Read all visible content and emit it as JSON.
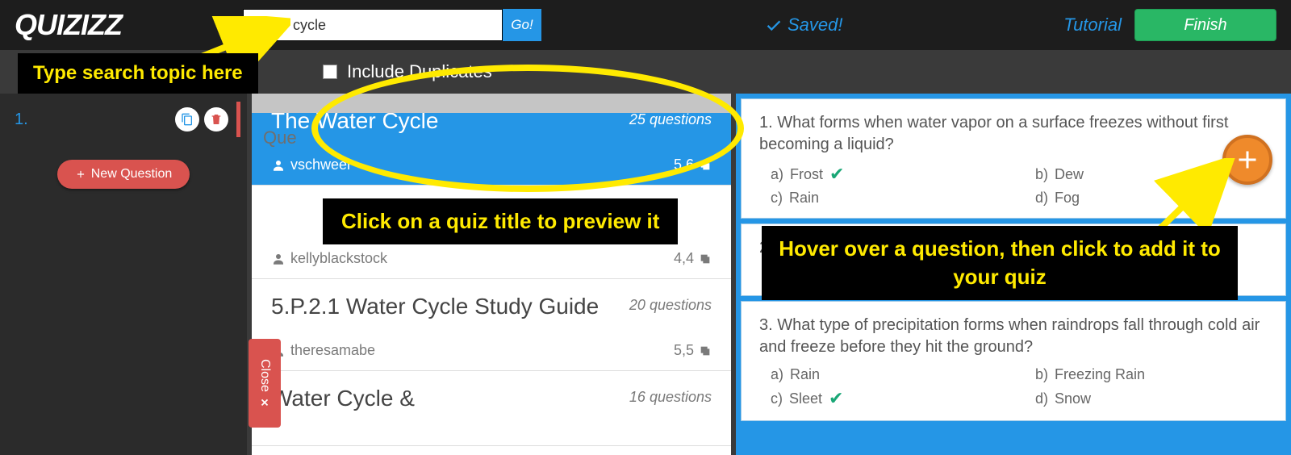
{
  "header": {
    "logo": "QUIZIZZ",
    "search_value": "water cycle",
    "go_label": "Go!",
    "saved_label": "Saved!",
    "tutorial_label": "Tutorial",
    "finish_label": "Finish"
  },
  "subheader": {
    "include_duplicates_label": "Include Duplicates"
  },
  "sidebar": {
    "question_number": "1.",
    "new_question_label": "New Question",
    "questions_label": "Que",
    "close_label": "Close"
  },
  "quiz_results": [
    {
      "title": "The Water Cycle",
      "qcount": "25 questions",
      "author": "vschweer",
      "score": "5,6",
      "selected": true
    },
    {
      "title": "",
      "qcount": "",
      "author": "kellyblackstock",
      "score": "4,4",
      "selected": false
    },
    {
      "title": "5.P.2.1 Water Cycle Study Guide",
      "qcount": "20 questions",
      "author": "theresamabe",
      "score": "5,5",
      "selected": false
    },
    {
      "title": "Water Cycle &",
      "qcount": "16 questions",
      "author": "",
      "score": "",
      "selected": false
    }
  ],
  "questions": [
    {
      "num": "1.",
      "text": "What forms when water vapor on a surface freezes without first becoming a liquid?",
      "answers": [
        {
          "key": "a)",
          "label": "Frost",
          "correct": true
        },
        {
          "key": "b)",
          "label": "Dew",
          "correct": false
        },
        {
          "key": "c)",
          "label": "Rain",
          "correct": false
        },
        {
          "key": "d)",
          "label": "Fog",
          "correct": false
        }
      ],
      "show_add": true
    },
    {
      "num": "2.",
      "text": "",
      "answers": [],
      "show_add": false
    },
    {
      "num": "3.",
      "text": "What type of precipitation forms when raindrops fall through cold air and freeze before they hit the ground?",
      "answers": [
        {
          "key": "a)",
          "label": "Rain",
          "correct": false
        },
        {
          "key": "b)",
          "label": "Freezing Rain",
          "correct": false
        },
        {
          "key": "c)",
          "label": "Sleet",
          "correct": true
        },
        {
          "key": "d)",
          "label": "Snow",
          "correct": false
        }
      ],
      "show_add": false
    }
  ],
  "annotations": {
    "a1": "Type search topic here",
    "a2": "Click on a quiz title to preview it",
    "a3": "Hover over a question, then click to add it to your quiz"
  }
}
